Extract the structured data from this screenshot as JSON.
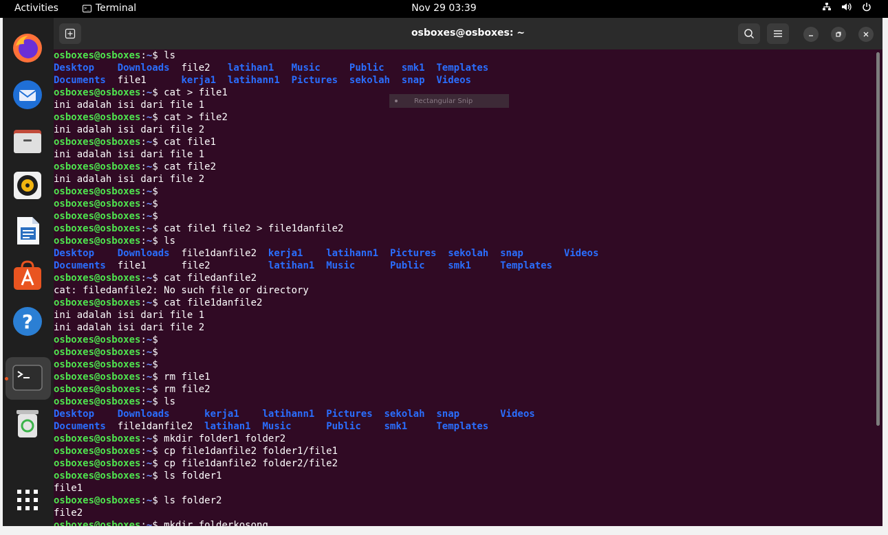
{
  "topbar": {
    "activities": "Activities",
    "app_name": "Terminal",
    "clock": "Nov 29  03:39"
  },
  "window": {
    "title": "osboxes@osboxes: ~"
  },
  "prompt": {
    "user": "osboxes@osboxes",
    "sep": ":",
    "path": "~",
    "dollar": "$"
  },
  "overlay": {
    "snip_label": "Rectangular Snip"
  },
  "dock": [
    "firefox-icon",
    "thunderbird-icon",
    "files-icon",
    "rhythmbox-icon",
    "writer-icon",
    "software-icon",
    "help-icon",
    "terminal-icon",
    "trash-icon",
    "app-grid-icon"
  ],
  "colors": {
    "terminal_bg": "#300a24",
    "prompt_user": "#4ee44e",
    "prompt_path": "#6d8fff",
    "directory": "#2a6eff",
    "accent": "#e95420"
  },
  "terminal": {
    "lines": [
      {
        "type": "prompt",
        "cmd": " ls"
      },
      {
        "type": "cols",
        "cells": [
          {
            "t": "Desktop",
            "c": 0,
            "d": 1
          },
          {
            "t": "Downloads",
            "c": 11,
            "d": 1
          },
          {
            "t": "file2",
            "c": 22,
            "d": 0
          },
          {
            "t": "latihan1",
            "c": 30,
            "d": 1
          },
          {
            "t": "Music",
            "c": 41,
            "d": 1
          },
          {
            "t": "Public",
            "c": 51,
            "d": 1
          },
          {
            "t": "smk1",
            "c": 60,
            "d": 1
          },
          {
            "t": "Templates",
            "c": 66,
            "d": 1
          }
        ]
      },
      {
        "type": "cols",
        "cells": [
          {
            "t": "Documents",
            "c": 0,
            "d": 1
          },
          {
            "t": "file1",
            "c": 11,
            "d": 0
          },
          {
            "t": "kerja1",
            "c": 22,
            "d": 1
          },
          {
            "t": "latihann1",
            "c": 30,
            "d": 1
          },
          {
            "t": "Pictures",
            "c": 41,
            "d": 1
          },
          {
            "t": "sekolah",
            "c": 51,
            "d": 1
          },
          {
            "t": "snap",
            "c": 60,
            "d": 1
          },
          {
            "t": "Videos",
            "c": 66,
            "d": 1
          }
        ]
      },
      {
        "type": "prompt",
        "cmd": " cat > file1"
      },
      {
        "type": "text",
        "text": "ini adalah isi dari file 1"
      },
      {
        "type": "prompt",
        "cmd": " cat > file2"
      },
      {
        "type": "text",
        "text": "ini adalah isi dari file 2"
      },
      {
        "type": "prompt",
        "cmd": " cat file1"
      },
      {
        "type": "text",
        "text": "ini adalah isi dari file 1"
      },
      {
        "type": "prompt",
        "cmd": " cat file2"
      },
      {
        "type": "text",
        "text": "ini adalah isi dari file 2"
      },
      {
        "type": "prompt",
        "cmd": ""
      },
      {
        "type": "prompt",
        "cmd": ""
      },
      {
        "type": "prompt",
        "cmd": ""
      },
      {
        "type": "prompt",
        "cmd": " cat file1 file2 > file1danfile2"
      },
      {
        "type": "prompt",
        "cmd": " ls"
      },
      {
        "type": "cols",
        "cells": [
          {
            "t": "Desktop",
            "c": 0,
            "d": 1
          },
          {
            "t": "Downloads",
            "c": 11,
            "d": 1
          },
          {
            "t": "file1danfile2",
            "c": 22,
            "d": 0
          },
          {
            "t": "kerja1",
            "c": 37,
            "d": 1
          },
          {
            "t": "latihann1",
            "c": 47,
            "d": 1
          },
          {
            "t": "Pictures",
            "c": 58,
            "d": 1
          },
          {
            "t": "sekolah",
            "c": 68,
            "d": 1
          },
          {
            "t": "snap",
            "c": 77,
            "d": 1
          },
          {
            "t": "Videos",
            "c": 88,
            "d": 1
          }
        ]
      },
      {
        "type": "cols",
        "cells": [
          {
            "t": "Documents",
            "c": 0,
            "d": 1
          },
          {
            "t": "file1",
            "c": 11,
            "d": 0
          },
          {
            "t": "file2",
            "c": 22,
            "d": 0
          },
          {
            "t": "latihan1",
            "c": 37,
            "d": 1
          },
          {
            "t": "Music",
            "c": 47,
            "d": 1
          },
          {
            "t": "Public",
            "c": 58,
            "d": 1
          },
          {
            "t": "smk1",
            "c": 68,
            "d": 1
          },
          {
            "t": "Templates",
            "c": 77,
            "d": 1
          }
        ]
      },
      {
        "type": "prompt",
        "cmd": " cat filedanfile2"
      },
      {
        "type": "text",
        "text": "cat: filedanfile2: No such file or directory"
      },
      {
        "type": "prompt",
        "cmd": " cat file1danfile2"
      },
      {
        "type": "text",
        "text": "ini adalah isi dari file 1"
      },
      {
        "type": "text",
        "text": "ini adalah isi dari file 2"
      },
      {
        "type": "prompt",
        "cmd": ""
      },
      {
        "type": "prompt",
        "cmd": ""
      },
      {
        "type": "prompt",
        "cmd": ""
      },
      {
        "type": "prompt",
        "cmd": " rm file1"
      },
      {
        "type": "prompt",
        "cmd": " rm file2"
      },
      {
        "type": "prompt",
        "cmd": " ls"
      },
      {
        "type": "cols",
        "cells": [
          {
            "t": "Desktop",
            "c": 0,
            "d": 1
          },
          {
            "t": "Downloads",
            "c": 11,
            "d": 1
          },
          {
            "t": "kerja1",
            "c": 26,
            "d": 1
          },
          {
            "t": "latihann1",
            "c": 36,
            "d": 1
          },
          {
            "t": "Pictures",
            "c": 47,
            "d": 1
          },
          {
            "t": "sekolah",
            "c": 57,
            "d": 1
          },
          {
            "t": "snap",
            "c": 66,
            "d": 1
          },
          {
            "t": "Videos",
            "c": 77,
            "d": 1
          }
        ]
      },
      {
        "type": "cols",
        "cells": [
          {
            "t": "Documents",
            "c": 0,
            "d": 1
          },
          {
            "t": "file1danfile2",
            "c": 11,
            "d": 0
          },
          {
            "t": "latihan1",
            "c": 26,
            "d": 1
          },
          {
            "t": "Music",
            "c": 36,
            "d": 1
          },
          {
            "t": "Public",
            "c": 47,
            "d": 1
          },
          {
            "t": "smk1",
            "c": 57,
            "d": 1
          },
          {
            "t": "Templates",
            "c": 66,
            "d": 1
          }
        ]
      },
      {
        "type": "prompt",
        "cmd": " mkdir folder1 folder2"
      },
      {
        "type": "prompt",
        "cmd": " cp file1danfile2 folder1/file1"
      },
      {
        "type": "prompt",
        "cmd": " cp file1danfile2 folder2/file2"
      },
      {
        "type": "prompt",
        "cmd": " ls folder1"
      },
      {
        "type": "text",
        "text": "file1"
      },
      {
        "type": "prompt",
        "cmd": " ls folder2"
      },
      {
        "type": "text",
        "text": "file2"
      },
      {
        "type": "prompt",
        "cmd": " mkdir folderkosong"
      }
    ]
  }
}
